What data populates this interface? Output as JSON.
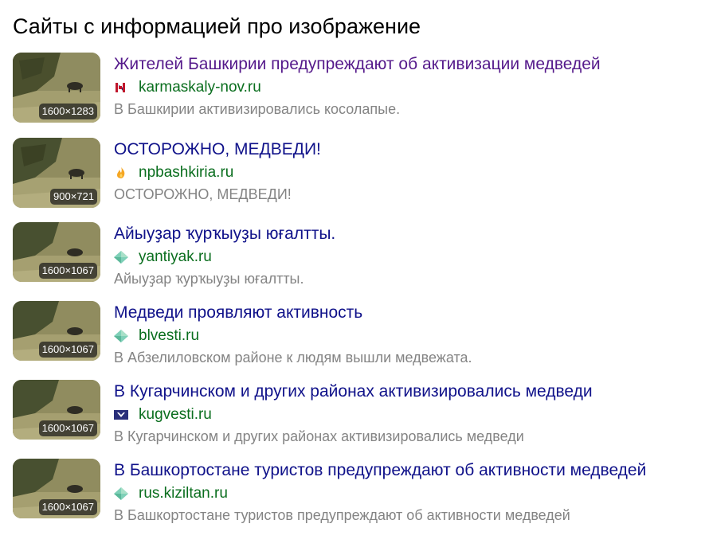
{
  "page_title": "Сайты с информацией про изображение",
  "colors": {
    "link": "#10128a",
    "visited_link": "#551a8b",
    "domain": "#0a6e1e",
    "snippet": "#848484"
  },
  "results": [
    {
      "title": "Жителей Башкирии предупреждают об активизации медведей",
      "visited": true,
      "domain": "karmaskaly-nov.ru",
      "favicon": "karmaskaly-logo-icon",
      "snippet": "В Башкирии активизировались косолапые.",
      "size": "1600×1283"
    },
    {
      "title": "ОСТОРОЖНО, МЕДВЕДИ!",
      "visited": false,
      "domain": "npbashkiria.ru",
      "favicon": "flame-icon",
      "snippet": "ОСТОРОЖНО, МЕДВЕДИ!",
      "size": "900×721"
    },
    {
      "title": "Айыуҙар ҡурҡыуҙы юғалтты.",
      "visited": false,
      "domain": "yantiyak.ru",
      "favicon": "diamond-icon",
      "snippet": "Айыуҙар ҡурҡыуҙы юғалтты.",
      "size": "1600×1067"
    },
    {
      "title": "Медведи проявляют активность",
      "visited": false,
      "domain": "blvesti.ru",
      "favicon": "diamond-icon",
      "snippet": "В Абзелиловском районе к людям вышли медвежата.",
      "size": "1600×1067"
    },
    {
      "title": "В Кугарчинском и других районах активизировались медведи",
      "visited": false,
      "domain": "kugvesti.ru",
      "favicon": "kugvesti-logo-icon",
      "snippet": "В Кугарчинском и других районах активизировались медведи",
      "size": "1600×1067"
    },
    {
      "title": "В Башкортостане туристов предупреждают об активности медведей",
      "visited": false,
      "domain": "rus.kiziltan.ru",
      "favicon": "diamond-icon",
      "snippet": "В Башкортостане туристов предупреждают об активности медведей",
      "size": "1600×1067"
    }
  ]
}
